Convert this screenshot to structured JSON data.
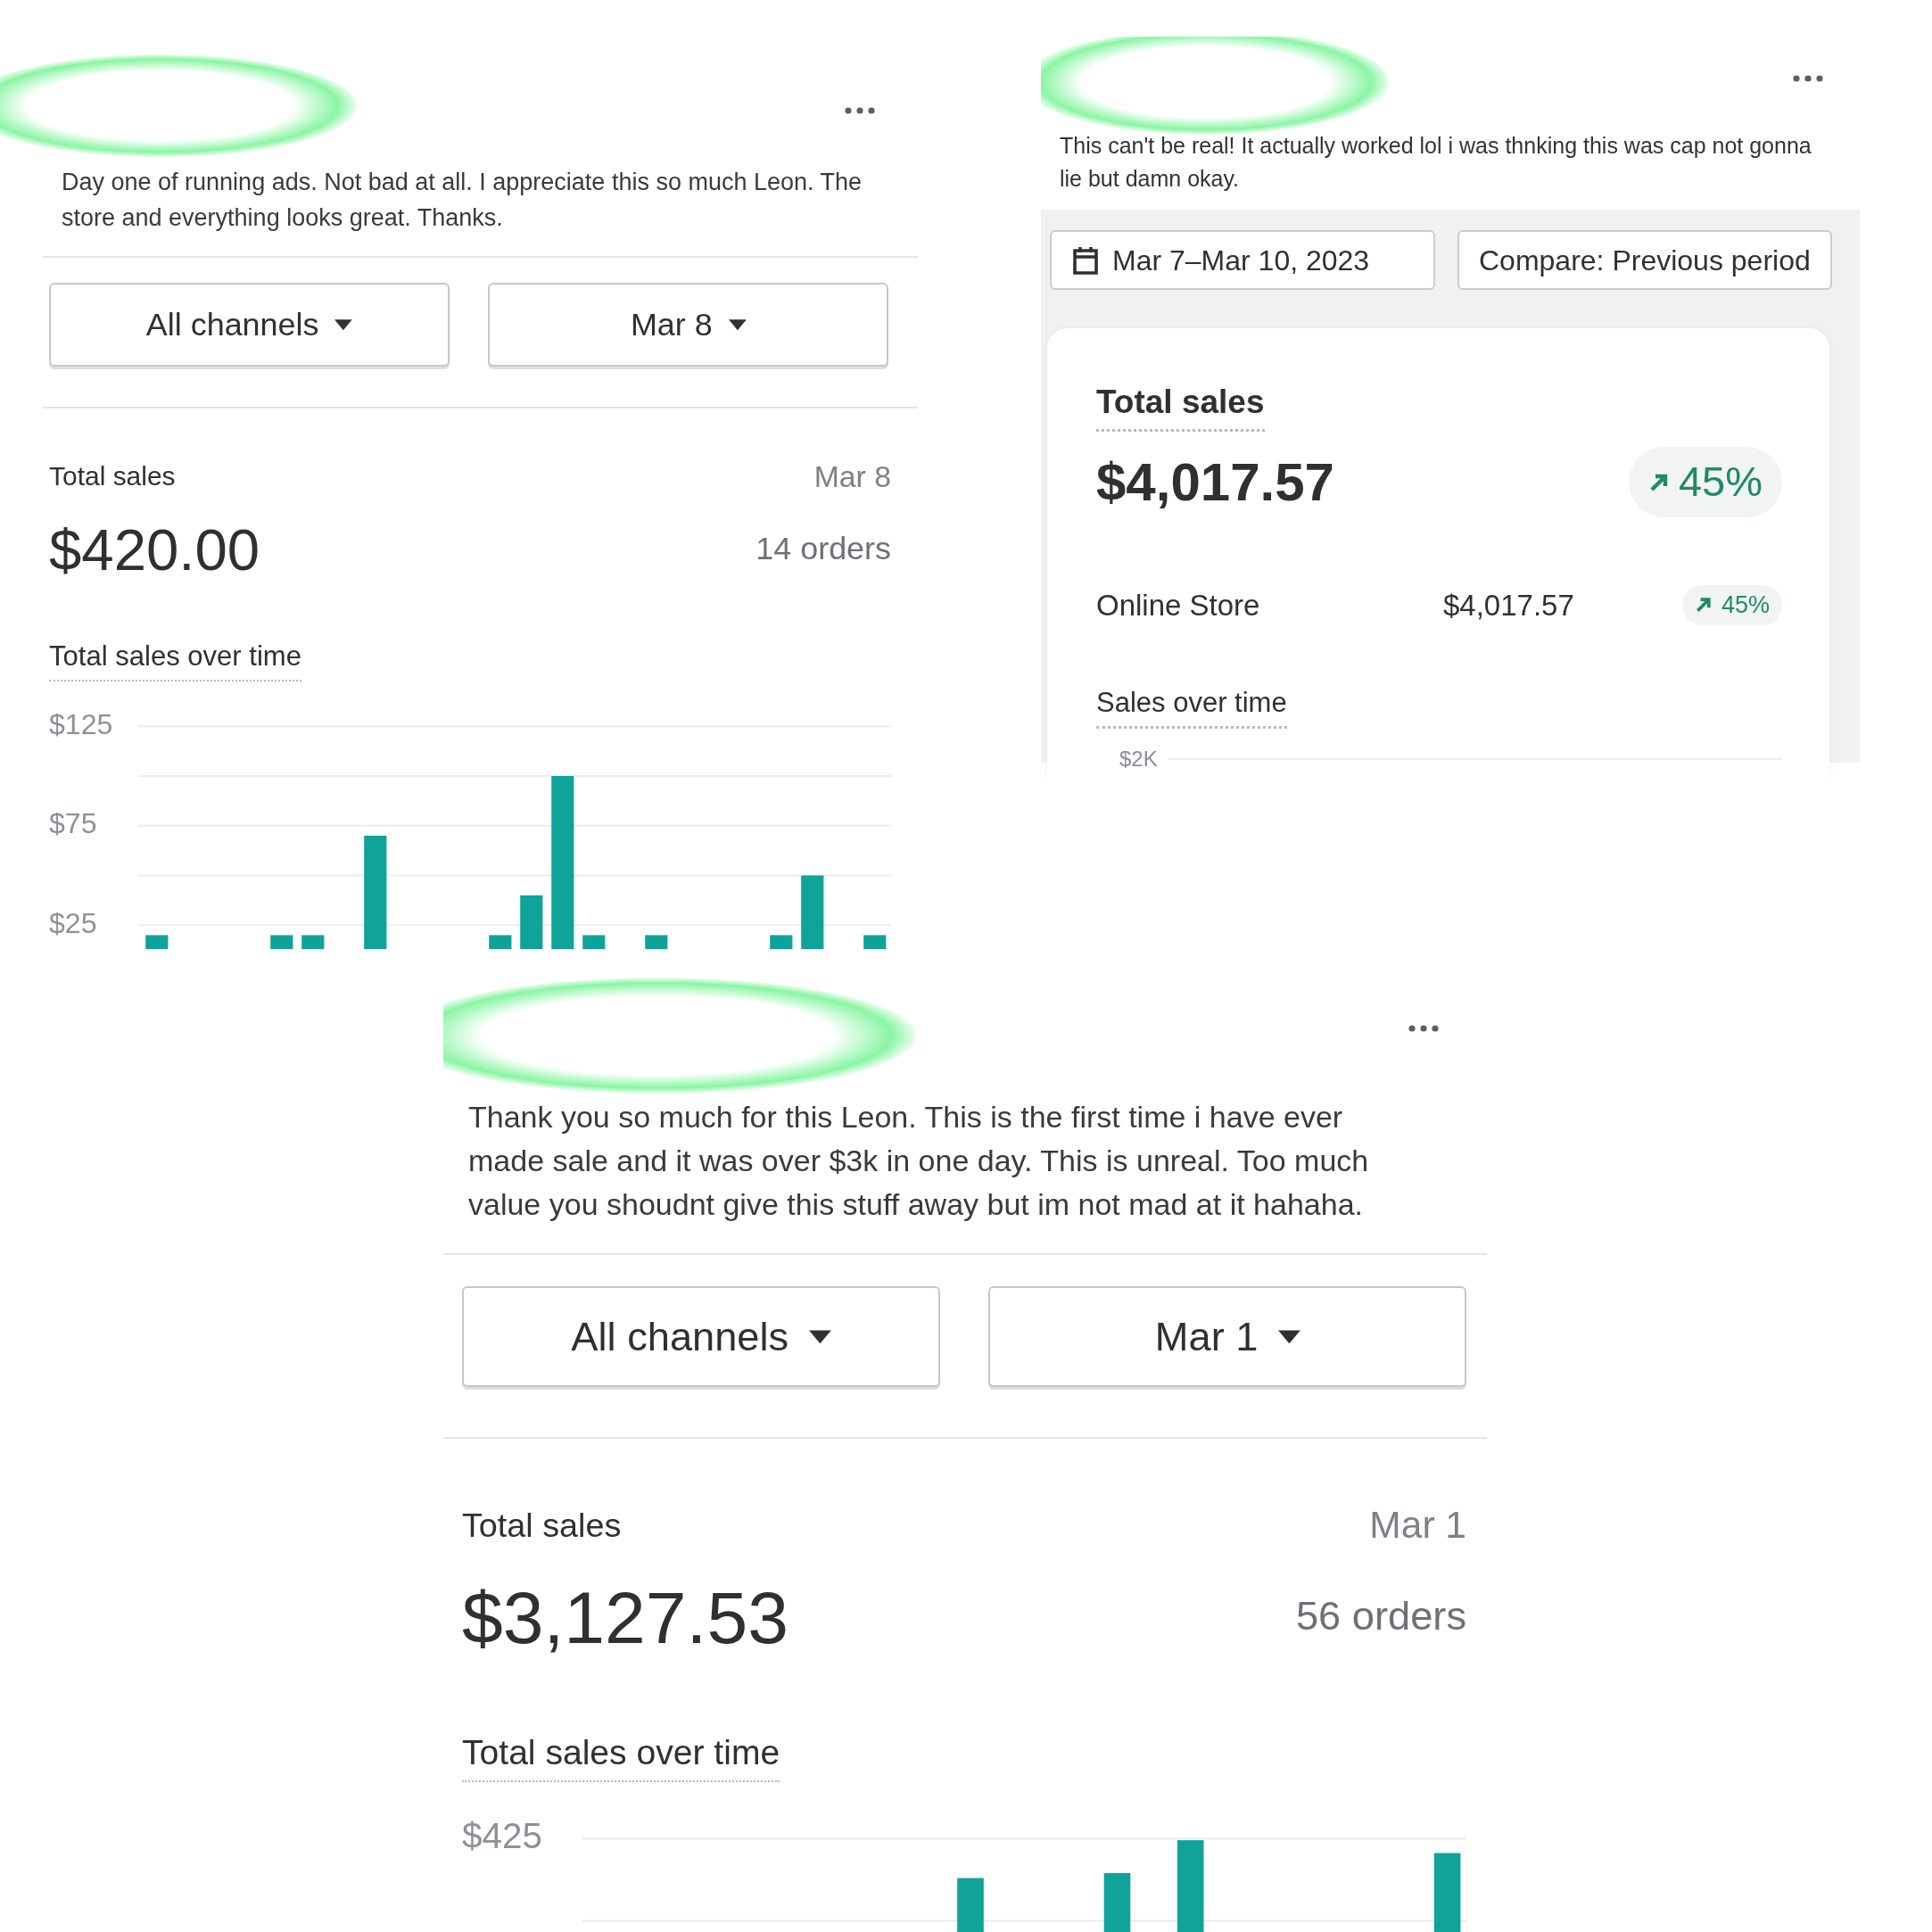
{
  "posts": [
    {
      "kind": "daily",
      "comment": "Day one of running ads. Not bad at all. I appreciate this so much Leon. The store and everything looks great. Thanks.",
      "filters": [
        "All channels",
        "Mar 8"
      ],
      "summary": {
        "title": "Total sales",
        "date": "Mar 8",
        "amount": "$420.00",
        "orders": "14 orders"
      },
      "chart_title": "Total sales over time",
      "chart_data": {
        "type": "bar",
        "grid": true,
        "categories": [
          null,
          null,
          null,
          null,
          null,
          null,
          null,
          null,
          null,
          null,
          null,
          null,
          null,
          null,
          null,
          null,
          null,
          null,
          null,
          null,
          null,
          null,
          null,
          null
        ],
        "ylim": [
          13,
          125
        ],
        "yticks": [
          {
            "value": 125,
            "label": "$125"
          },
          {
            "value": 75,
            "label": "$75"
          },
          {
            "value": 25,
            "label": "$25"
          }
        ],
        "values": [
          20,
          null,
          null,
          null,
          20,
          20,
          null,
          70,
          null,
          null,
          null,
          20,
          40,
          100,
          20,
          null,
          20,
          null,
          null,
          null,
          20,
          50,
          null,
          20
        ]
      }
    },
    {
      "kind": "range",
      "comment": "This can't be real! It actually worked lol i was thnking this was cap not gonna lie but damn okay.",
      "date_range": "Mar 7–Mar 10, 2023",
      "compare": "Compare: Previous period",
      "summary": {
        "title": "Total sales",
        "amount": "$4,017.57",
        "change": "45%",
        "channels": [
          {
            "name": "Online Store",
            "amount": "$4,017.57",
            "change": "45%"
          }
        ]
      },
      "chart_title": "Sales over time",
      "axis_label": "$2K"
    },
    {
      "kind": "daily",
      "comment": "Thank you so much for this Leon. This is the first time i have ever made sale and it was over $3k in one day. This is unreal. Too much value you shoudnt give this stuff away but im not mad at it hahaha.",
      "filters": [
        "All channels",
        "Mar 1"
      ],
      "summary": {
        "title": "Total sales",
        "date": "Mar 1",
        "amount": "$3,127.53",
        "orders": "56 orders"
      },
      "chart_title": "Total sales over time",
      "axis_label": "$425"
    }
  ]
}
